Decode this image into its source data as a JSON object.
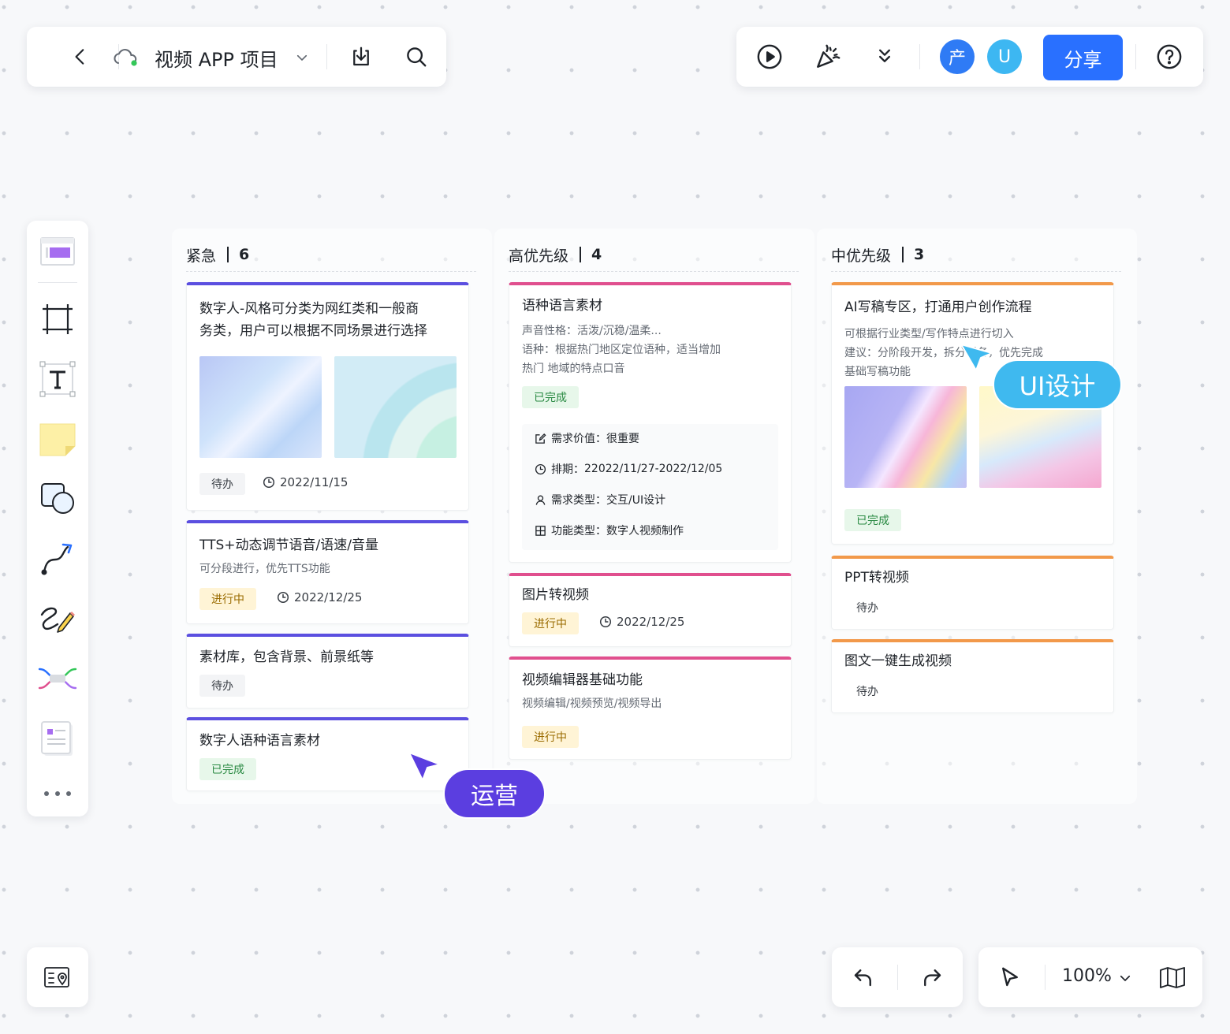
{
  "project": {
    "title": "视频 APP 项目"
  },
  "topbar": {
    "avatars": [
      {
        "initial": "产",
        "color": "#2f7bf5"
      },
      {
        "initial": "U",
        "color": "#3db7f2"
      }
    ],
    "share_label": "分享"
  },
  "toolbar": {
    "tools": [
      "template",
      "frame",
      "text",
      "sticky-note",
      "shape",
      "connector",
      "pen",
      "mindmap",
      "document",
      "more"
    ]
  },
  "view": {
    "zoom": "100%"
  },
  "columns": [
    {
      "name": "紧急",
      "count": "6",
      "accent": "#5b4fe0",
      "cards": [
        {
          "title_lines": [
            "数字人-风格可分类为网红类和一般商",
            "务类，用户可以根据不同场景进行选择"
          ],
          "status": "待办",
          "date": "2022/11/15"
        },
        {
          "title": "TTS+动态调节语音/语速/音量",
          "desc": "可分段进行，优先TTS功能",
          "status": "进行中",
          "date": "2022/12/25"
        },
        {
          "title": "素材库，包含背景、前景纸等",
          "status": "待办"
        },
        {
          "title": "数字人语种语言素材",
          "status": "已完成"
        }
      ]
    },
    {
      "name": "高优先级",
      "count": "4",
      "accent": "#e04f8e",
      "cards": [
        {
          "title": "语种语言素材",
          "desc_lines": [
            "声音性格：活泼/沉稳/温柔...",
            "语种：根据热门地区定位语种，适当增加",
            "热门   地域的特点口音"
          ],
          "status": "已完成",
          "details": [
            {
              "label": "需求价值：",
              "value": "很重要"
            },
            {
              "label": "排期：",
              "value": "22022/11/27-2022/12/05"
            },
            {
              "label": "需求类型：",
              "value": "交互/UI设计"
            },
            {
              "label": "功能类型：",
              "value": "数字人视频制作"
            }
          ]
        },
        {
          "title": "图片转视频",
          "status": "进行中",
          "date": "2022/12/25"
        },
        {
          "title": "视频编辑器基础功能",
          "desc": "视频编辑/视频预览/视频导出",
          "status": "进行中"
        }
      ]
    },
    {
      "name": "中优先级",
      "count": "3",
      "accent": "#f2994a",
      "cards": [
        {
          "title": "AI写稿专区，打通用户创作流程",
          "desc_lines": [
            "   可根据行业类型/写作特点进行切入",
            "建议：分阶段开发，拆分任务，优先完成",
            "基础写稿功能"
          ],
          "status": "已完成"
        },
        {
          "title": "PPT转视频",
          "status": "待办"
        },
        {
          "title": "图文一键生成视频",
          "status": "待办"
        }
      ]
    }
  ],
  "cursors": [
    {
      "label": "运营",
      "color": "#5b3ee0"
    },
    {
      "label": "UI设计",
      "color": "#3fb9ef"
    }
  ]
}
